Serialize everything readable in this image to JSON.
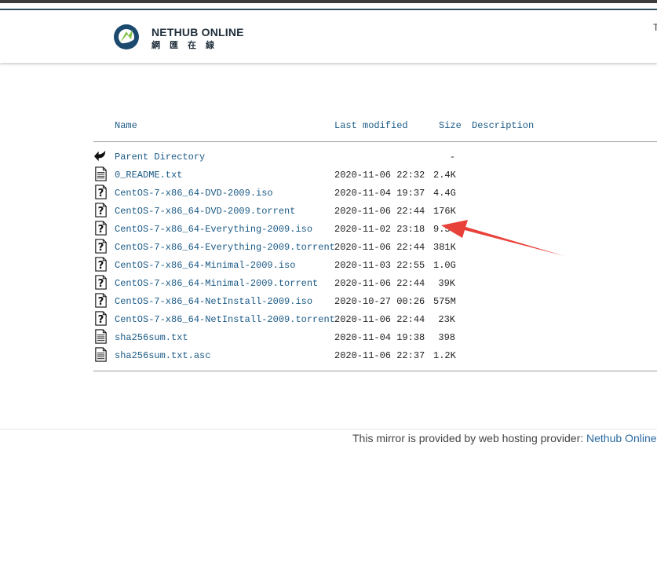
{
  "header": {
    "logo_en": "NETHUB ONLINE",
    "logo_zh": "網匯在線",
    "edge_text": "T"
  },
  "listing": {
    "columns": {
      "name": "Name",
      "modified": "Last modified",
      "size": "Size",
      "description": "Description"
    },
    "rows": [
      {
        "name": "Parent Directory",
        "date": "",
        "size": "-",
        "icon": "back-arrow-icon"
      },
      {
        "name": "0_README.txt",
        "date": "2020-11-06 22:32",
        "size": "2.4K",
        "icon": "text-file-icon"
      },
      {
        "name": "CentOS-7-x86_64-DVD-2009.iso",
        "date": "2020-11-04 19:37",
        "size": "4.4G",
        "icon": "unknown-file-icon"
      },
      {
        "name": "CentOS-7-x86_64-DVD-2009.torrent",
        "date": "2020-11-06 22:44",
        "size": "176K",
        "icon": "unknown-file-icon"
      },
      {
        "name": "CentOS-7-x86_64-Everything-2009.iso",
        "date": "2020-11-02 23:18",
        "size": "9.5G",
        "icon": "unknown-file-icon"
      },
      {
        "name": "CentOS-7-x86_64-Everything-2009.torrent",
        "date": "2020-11-06 22:44",
        "size": "381K",
        "icon": "unknown-file-icon"
      },
      {
        "name": "CentOS-7-x86_64-Minimal-2009.iso",
        "date": "2020-11-03 22:55",
        "size": "1.0G",
        "icon": "unknown-file-icon"
      },
      {
        "name": "CentOS-7-x86_64-Minimal-2009.torrent",
        "date": "2020-11-06 22:44",
        "size": "39K",
        "icon": "unknown-file-icon"
      },
      {
        "name": "CentOS-7-x86_64-NetInstall-2009.iso",
        "date": "2020-10-27 00:26",
        "size": "575M",
        "icon": "unknown-file-icon"
      },
      {
        "name": "CentOS-7-x86_64-NetInstall-2009.torrent",
        "date": "2020-11-06 22:44",
        "size": "23K",
        "icon": "unknown-file-icon"
      },
      {
        "name": "sha256sum.txt",
        "date": "2020-11-04 19:38",
        "size": "398",
        "icon": "text-file-icon"
      },
      {
        "name": "sha256sum.txt.asc",
        "date": "2020-11-06 22:37",
        "size": "1.2K",
        "icon": "text-file-icon"
      }
    ]
  },
  "footer": {
    "text": "This mirror is provided by web hosting provider: ",
    "link": "Nethub Online"
  },
  "annotation": {
    "arrow_color": "#e8413a"
  }
}
